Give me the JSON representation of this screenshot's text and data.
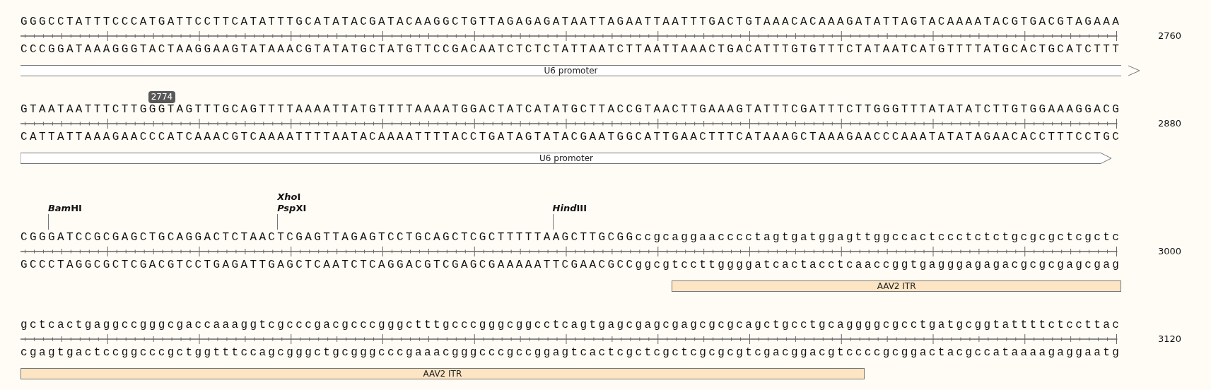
{
  "blocks": [
    {
      "top": "GGGCCTATTTCCCATGATTCCTTCATATTTGCATATACGATACAAGGCTGTTAGAGAGATAATTAGAATTAATTTGACTGTAAACACAAAGATATTAGTACAAAATACGTGACGTAGAAA",
      "bottom": "CCCGGATAAAGGGTACTAAGGAAGTATAAACGTATATGCTATGTTCCGACAATCTCTCTATTAATCTTAATTAAACTGACATTTGTGTTTCTATAATCATGTTTTATGCACTGCATCTTT",
      "number": "2760",
      "features": [
        {
          "label": "U6 promoter",
          "kind": "arrow",
          "continues_after": true
        }
      ]
    },
    {
      "markers": [
        {
          "label": "2774"
        }
      ],
      "top": "GTAATAATTTCTTGGGTAGTTTGCAGTTTTAAAATTATGTTTTAAAATGGACTATCATATGCTTACCGTAACTTGAAAGTATTTCGATTTCTTGGGTTTATATATCTTGTGGAAAGGACG",
      "bottom": "CATTATTAAAGAACCCATCAAACGTCAAAATTTTAATACAAAATTTTACCTGATAGTATACGAATGGCATTGAACTTTCATAAAGCTAAAGAACCCAAATATATAGAACACCTTTCCTGC",
      "number": "2880",
      "features": [
        {
          "label": "U6 promoter",
          "kind": "arrow",
          "continues_after": false
        }
      ]
    },
    {
      "sites": [
        {
          "names": [
            {
              "italic": "Bam",
              "rest": "HI"
            }
          ]
        },
        {
          "names": [
            {
              "italic": "Xho",
              "rest": "I"
            },
            {
              "italic": "Psp",
              "rest": "XI"
            }
          ]
        },
        {
          "names": [
            {
              "italic": "Hind",
              "rest": "III"
            }
          ]
        }
      ],
      "top": "CGGGATCCGCGAGCTGCAGGACTCTAACTCGAGTTAGAGTCCTGCAGCTCGCTTTTTAAGCTTGCGGccgcaggaacccctagtgatggagttggccactccctctctgcgcgctcgctc",
      "bottom": "GCCCTAGGCGCTCGACGTCCTGAGATTGAGCTCAATCTCAGGACGTCGAGCGAAAAATTCGAACGCCggcgtccttggggatcactacctcaaccggtgagggagagacgcgcgagcgag",
      "number": "3000",
      "features": [
        {
          "label": "AAV2 ITR",
          "kind": "box"
        }
      ]
    },
    {
      "top": "gctcactgaggccgggcgaccaaaggtcgcccgacgcccgggctttgcccgggcggcctcagtgagcgagcgagcgcgcagctgcctgcaggggcgcctgatgcggtattttctccttac",
      "bottom": "cgagtgactccggcccgctggtttccagcgggctgcgggcccgaaacgggcccgccggagtcactcgctcgctcgcgcgtcgacggacgtccccgcggactacgccataaaagaggaatg",
      "number": "3120",
      "features": [
        {
          "label": "AAV2 ITR",
          "kind": "box"
        }
      ]
    }
  ]
}
